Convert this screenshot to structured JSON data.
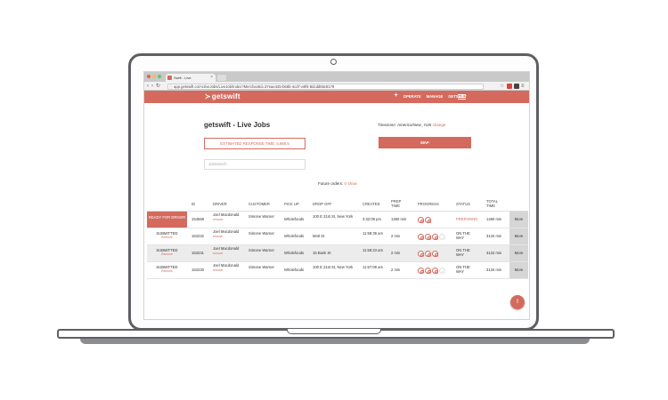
{
  "browser": {
    "tab_title": "Swift - Live",
    "url": "app.getswift.co/Active/Jobs/LiveJob?MerchantId=37eae435-b68b-4cd7-a9f4-8dc8d65c8178",
    "url_display": "app.getswift.co/ActiveJobs/LiveJob/Index?MerchantId=37eae435-b68b-4cd7-a9f4-8dcdd65c8178"
  },
  "nav": {
    "brand": "getswift",
    "plus": "+",
    "links": [
      "OPERATE",
      "MANAGE",
      "GETSHIFT"
    ]
  },
  "page": {
    "title": "getswift - Live Jobs",
    "timezone_label": "Timezone: America/New_York",
    "timezone_change": "change",
    "estimated_button": "ESTIMATED RESPONSE TIME: 5,880.5",
    "map_button": "MAP",
    "search_placeholder": "JobSearch",
    "future_orders_label": "Future orders:",
    "future_orders_count": "0",
    "future_orders_link": "show"
  },
  "table": {
    "headers": [
      "ID",
      "DRIVER",
      "CUSTOMER",
      "PICK UP",
      "DROP OFF",
      "CREATED",
      "PREP TIME",
      "PROGRESS",
      "STATUS",
      "TOTAL TIME"
    ],
    "rows": [
      {
        "state": "READY FOR DRIVER",
        "state_link": "",
        "id": "154588",
        "driver": "Joel Macdonald",
        "driver_link": "remove",
        "customer": "Simone Warner",
        "pickup": "Wholefoods",
        "dropoff": "100 E 21st St, New York",
        "created": "3:32:09 pm",
        "prep": "1480 min",
        "progress": 2,
        "status": "PREPARING",
        "total": "1480 min",
        "more": "More"
      },
      {
        "state": "SUBMITTED",
        "state_link": "Remove",
        "id": "153232",
        "driver": "Joel Macdonald",
        "driver_link": "remove",
        "customer": "Simone Warner",
        "pickup": "Wholefoods",
        "dropoff": "Mott St",
        "created": "11:58:39 am",
        "prep": "2 min",
        "progress": 3,
        "status": "ON THE WAY",
        "total": "3134 min",
        "more": "More"
      },
      {
        "state": "SUBMITTED",
        "state_link": "Remove",
        "id": "153231",
        "driver": "Joel Macdonald",
        "driver_link": "remove",
        "customer": "Simone Warner",
        "pickup": "Wholefoods",
        "dropoff": "15 Bank St",
        "created": "11:58:23 am",
        "prep": "2 min",
        "progress": 3,
        "status": "ON THE WAY",
        "total": "3134 min",
        "more": "More"
      },
      {
        "state": "SUBMITTED",
        "state_link": "Remove",
        "id": "153230",
        "driver": "Joel Macdonald",
        "driver_link": "remove",
        "customer": "Simone Warner",
        "pickup": "Wholefoods",
        "dropoff": "100 E 21st St, New York",
        "created": "11:57:09 am",
        "prep": "2 min",
        "progress": 3,
        "status": "ON THE WAY",
        "total": "3134 min",
        "more": "More"
      }
    ]
  },
  "colors": {
    "accent": "#d46a5e",
    "frame": "#5d5f63"
  },
  "icons": {
    "fab": "chat-icon"
  }
}
